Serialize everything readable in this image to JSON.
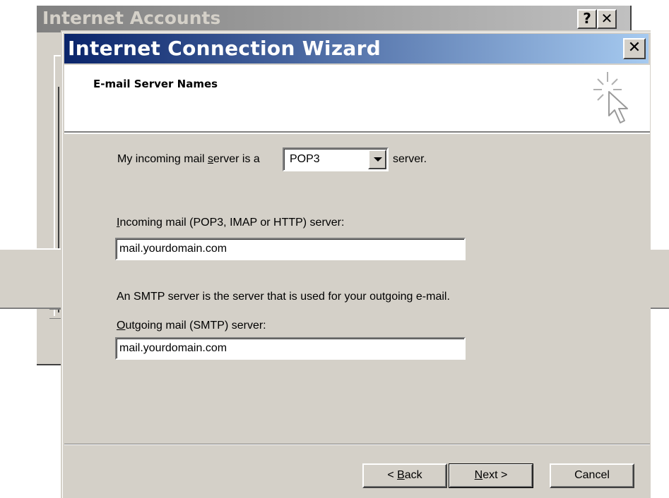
{
  "background_window": {
    "title": "Internet Accounts",
    "help_button": "?",
    "close_button": "✕"
  },
  "wizard": {
    "title": "Internet Connection Wizard",
    "close_button": "✕",
    "page_heading": "E-mail Server Names",
    "incoming_server_type": {
      "prefix": "My incoming mail ",
      "prefix_underlined": "s",
      "prefix_rest": "erver is a",
      "selected": "POP3",
      "suffix": "server."
    },
    "incoming_server": {
      "label_underlined": "I",
      "label_rest": "ncoming mail (POP3, IMAP or HTTP) server:",
      "value": "mail.yourdomain.com"
    },
    "smtp_info": "An SMTP server is the server that is used for your outgoing e-mail.",
    "outgoing_server": {
      "label_underlined": "O",
      "label_rest": "utgoing mail (SMTP) server:",
      "value": "mail.yourdomain.com"
    },
    "buttons": {
      "back_prefix": "< ",
      "back_underlined": "B",
      "back_rest": "ack",
      "next_underlined": "N",
      "next_rest": "ext >",
      "cancel": "Cancel"
    }
  },
  "colors": {
    "titlebar_active_start": "#0a246a",
    "titlebar_active_end": "#a6caf0",
    "dialog_face": "#d4d0c8"
  },
  "icons": {
    "wizard_icon": "cursor-sparkle-icon",
    "dropdown_icon": "chevron-down-icon",
    "close_icon": "close-icon",
    "help_icon": "help-icon"
  }
}
